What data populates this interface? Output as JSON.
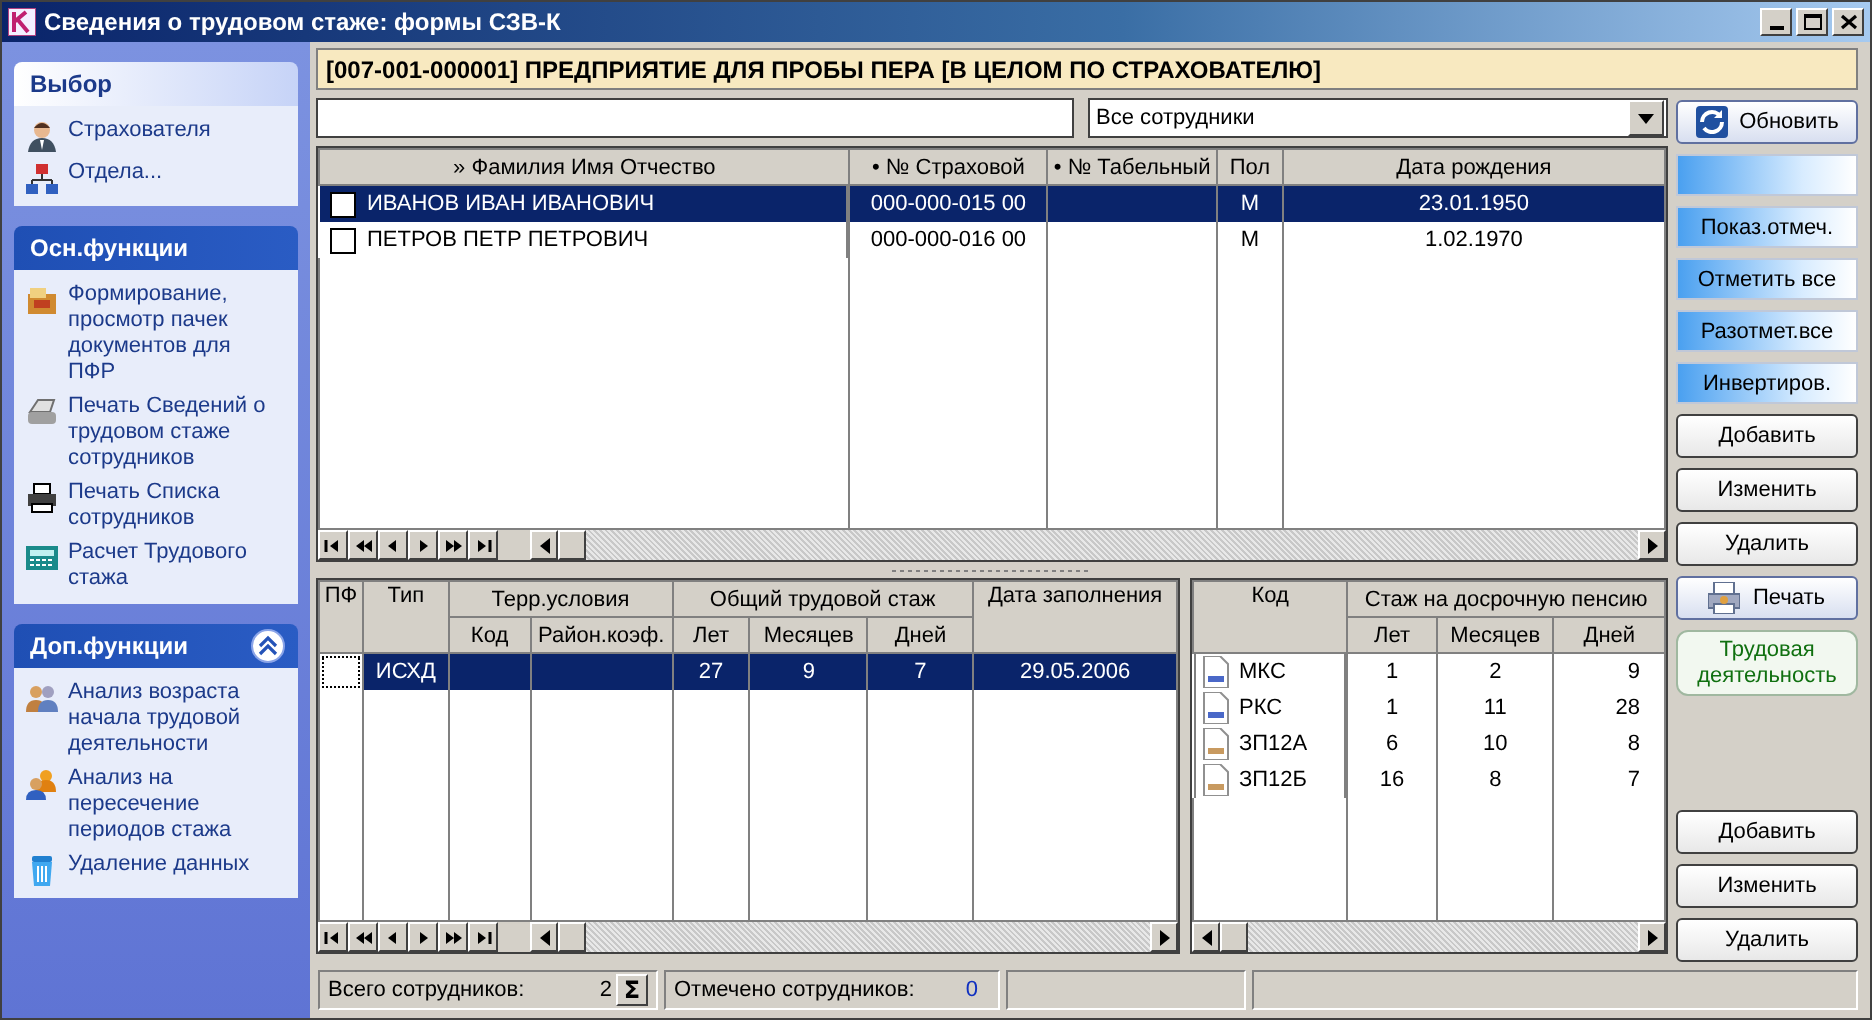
{
  "window": {
    "title": "Сведения о трудовом стаже: формы СЗВ-К"
  },
  "sidebar": {
    "groups": [
      {
        "title": "Выбор",
        "kind": "normal",
        "items": [
          {
            "label": "Страхователя"
          },
          {
            "label": "Отдела..."
          }
        ]
      },
      {
        "title": "Осн.функции",
        "kind": "special",
        "items": [
          {
            "label": "Формирование, просмотр пачек документов для ПФР"
          },
          {
            "label": "Печать Сведений о трудовом стаже сотрудников"
          },
          {
            "label": "Печать Списка сотрудников"
          },
          {
            "label": "Расчет Трудового стажа"
          }
        ]
      },
      {
        "title": "Доп.функции",
        "kind": "special",
        "expanded": true,
        "items": [
          {
            "label": "Анализ возраста начала трудовой деятельности"
          },
          {
            "label": "Анализ на пересечение периодов стажа"
          },
          {
            "label": "Удаление данных"
          }
        ]
      }
    ]
  },
  "header": {
    "title": "[007-001-000001] ПРЕДПРИЯТИЕ ДЛЯ ПРОБЫ ПЕРА [В ЦЕЛОМ ПО СТРАХОВАТЕЛЮ]"
  },
  "filter": {
    "dropdown": "Все сотрудники"
  },
  "employees": {
    "columns": [
      "» Фамилия Имя Отчество",
      "• № Страховой",
      "• № Табельный",
      "Пол",
      "Дата рождения"
    ],
    "rows": [
      {
        "checked": false,
        "selected": true,
        "name": "ИВАНОВ ИВАН ИВАНОВИЧ",
        "insurance_no": "000-000-015 00",
        "sex": "М",
        "birth_date": "23.01.1950"
      },
      {
        "checked": false,
        "selected": false,
        "name": "ПЕТРОВ ПЕТР ПЕТРОВИЧ",
        "insurance_no": "000-000-016 00",
        "sex": "М",
        "birth_date": "1.02.1970"
      }
    ]
  },
  "forms": {
    "columns": {
      "pf": "ПФ",
      "type": "Тип",
      "terr": "Терр.условия",
      "code": "Код",
      "coef": "Район.коэф.",
      "total": "Общий трудовой стаж",
      "years": "Лет",
      "months": "Месяцев",
      "days": "Дней",
      "date": "Дата заполнения"
    },
    "rows": [
      {
        "selected": true,
        "type": "ИСХД",
        "years": "27",
        "months": "9",
        "days": "7",
        "date": "29.05.2006"
      }
    ]
  },
  "early_pension": {
    "columns": {
      "code": "Код",
      "group": "Стаж на досрочную пенсию",
      "years": "Лет",
      "months": "Месяцев",
      "days": "Дней"
    },
    "rows": [
      {
        "code": "МКС",
        "color": "#4a68c8",
        "years": "1",
        "months": "2",
        "days": "9"
      },
      {
        "code": "РКС",
        "color": "#4a68c8",
        "years": "1",
        "months": "11",
        "days": "28"
      },
      {
        "code": "ЗП12А",
        "color": "#c89a60",
        "years": "6",
        "months": "10",
        "days": "8"
      },
      {
        "code": "ЗП12Б",
        "color": "#c89a60",
        "years": "16",
        "months": "8",
        "days": "7"
      }
    ]
  },
  "side_buttons_top": [
    {
      "kind": "command",
      "label": "Обновить"
    },
    {
      "kind": "toggle"
    },
    {
      "kind": "toggle",
      "label": "Показ.отмеч."
    },
    {
      "kind": "toggle",
      "label": "Отметить все"
    },
    {
      "kind": "toggle",
      "label": "Разотмет.все"
    },
    {
      "kind": "toggle",
      "label": "Инвертиров."
    },
    {
      "kind": "plain",
      "label": "Добавить"
    },
    {
      "kind": "plain",
      "label": "Изменить"
    },
    {
      "kind": "plain",
      "label": "Удалить"
    },
    {
      "kind": "command",
      "label": "Печать"
    },
    {
      "kind": "link",
      "label": "Трудовая деятельность"
    }
  ],
  "side_buttons_bottom": [
    {
      "kind": "plain",
      "label": "Добавить"
    },
    {
      "kind": "plain",
      "label": "Изменить"
    },
    {
      "kind": "plain",
      "label": "Удалить"
    }
  ],
  "status_bar": {
    "total_label": "Всего сотрудников:",
    "total": "2",
    "sum_button": "Σ",
    "marked_label": "Отмечено сотрудников:",
    "marked": "0"
  }
}
